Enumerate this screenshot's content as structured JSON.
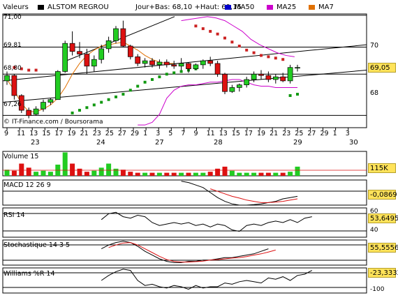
{
  "header": {
    "values_label": "Valeurs",
    "stock_name": "ALSTOM REGROU",
    "stats": "Jour+Bas: 68,10 +Haut: 69,15",
    "legend": [
      {
        "label": "MA50",
        "color": "#0000cc"
      },
      {
        "label": "MA25",
        "color": "#cc00cc"
      },
      {
        "label": "MA7",
        "color": "#e07000"
      }
    ]
  },
  "watermark": "© IT-Finance.com / Boursorama",
  "price_panel": {
    "last_value": "69,05",
    "y_ticks": [
      "70",
      "68"
    ],
    "level_labels": [
      "71,00",
      "69,81",
      "68,80",
      "67,26"
    ]
  },
  "x_axis": {
    "ticks": [
      "9",
      "11",
      "13",
      "15",
      "17",
      "19",
      "21",
      "23",
      "25",
      "27",
      "29",
      "1",
      "3",
      "5",
      "7",
      "9",
      "11",
      "13",
      "15",
      "17",
      "19",
      "21",
      "23",
      "25",
      "27",
      "29",
      "1",
      "3"
    ],
    "days": [
      "23",
      "24",
      "27",
      "28",
      "29",
      "30"
    ]
  },
  "volume_panel": {
    "label": "Volume 15",
    "value": "115K"
  },
  "macd_panel": {
    "label": "MACD 12 26 9",
    "value": "-0,0869"
  },
  "rsi_panel": {
    "label": "RSI 14",
    "value": "53,6495",
    "y_ticks": [
      "60",
      "40"
    ]
  },
  "stoch_panel": {
    "label": "Stochastique 14 3 5",
    "value": "55,5556"
  },
  "williams_panel": {
    "label": "Williams %R 14",
    "value": "-23,3332",
    "y_ticks": [
      "-100"
    ]
  },
  "colors": {
    "up": "#22cc22",
    "down": "#dd1111",
    "psar_up": "#119911",
    "psar_down": "#cc2222",
    "ma7": "#e07000",
    "ma25": "#cc00cc",
    "ma50": "#0000cc",
    "panel_bg": "#fff"
  },
  "chart_data": {
    "type": "candlestick",
    "x_range": [
      0,
      46
    ],
    "ylim": [
      66.8,
      71.05
    ],
    "candles": [
      [
        68.55,
        68.9,
        68.4,
        68.75
      ],
      [
        68.75,
        68.8,
        67.85,
        68.0
      ],
      [
        68.0,
        68.05,
        67.35,
        67.45
      ],
      [
        67.45,
        67.55,
        67.15,
        67.25
      ],
      [
        67.3,
        67.6,
        67.25,
        67.5
      ],
      [
        67.5,
        67.85,
        67.4,
        67.75
      ],
      [
        67.75,
        67.9,
        67.65,
        67.85
      ],
      [
        67.85,
        68.95,
        67.85,
        68.9
      ],
      [
        68.9,
        70.05,
        68.85,
        69.95
      ],
      [
        69.95,
        70.4,
        69.5,
        69.65
      ],
      [
        69.65,
        70.0,
        69.4,
        69.55
      ],
      [
        69.55,
        69.75,
        68.8,
        69.1
      ],
      [
        69.1,
        69.5,
        68.9,
        69.35
      ],
      [
        69.35,
        69.9,
        69.2,
        69.75
      ],
      [
        69.75,
        70.2,
        69.6,
        70.05
      ],
      [
        70.05,
        70.6,
        69.95,
        70.5
      ],
      [
        70.5,
        70.8,
        69.8,
        69.85
      ],
      [
        69.85,
        69.9,
        69.35,
        69.45
      ],
      [
        69.45,
        69.55,
        69.1,
        69.2
      ],
      [
        69.2,
        69.4,
        69.05,
        69.3
      ],
      [
        69.3,
        69.4,
        69.05,
        69.15
      ],
      [
        69.15,
        69.35,
        69.0,
        69.25
      ],
      [
        69.25,
        69.35,
        69.05,
        69.15
      ],
      [
        69.15,
        69.3,
        69.0,
        69.1
      ],
      [
        69.1,
        69.4,
        68.95,
        69.2
      ],
      [
        69.2,
        69.25,
        68.85,
        69.0
      ],
      [
        69.0,
        69.2,
        68.95,
        69.15
      ],
      [
        69.15,
        69.35,
        69.0,
        69.3
      ],
      [
        69.3,
        69.45,
        69.1,
        69.2
      ],
      [
        69.2,
        69.3,
        68.7,
        68.8
      ],
      [
        68.8,
        68.85,
        68.05,
        68.15
      ],
      [
        68.15,
        68.4,
        68.1,
        68.3
      ],
      [
        68.3,
        68.45,
        68.15,
        68.4
      ],
      [
        68.4,
        68.7,
        68.3,
        68.6
      ],
      [
        68.6,
        68.9,
        68.5,
        68.8
      ],
      [
        68.8,
        68.95,
        68.6,
        68.75
      ],
      [
        68.75,
        68.9,
        68.5,
        68.6
      ],
      [
        68.6,
        68.8,
        68.45,
        68.7
      ],
      [
        68.7,
        68.85,
        68.5,
        68.55
      ],
      [
        68.55,
        69.15,
        68.45,
        69.05
      ],
      [
        69.05,
        69.15,
        68.9,
        69.05
      ]
    ],
    "volume": [
      30,
      25,
      60,
      40,
      20,
      25,
      20,
      55,
      115,
      60,
      35,
      20,
      25,
      40,
      60,
      35,
      30,
      20,
      15,
      15,
      15,
      15,
      15,
      15,
      15,
      15,
      15,
      15,
      20,
      35,
      45,
      25,
      15,
      15,
      15,
      15,
      15,
      15,
      15,
      20,
      45
    ],
    "volume_max": 120
  }
}
